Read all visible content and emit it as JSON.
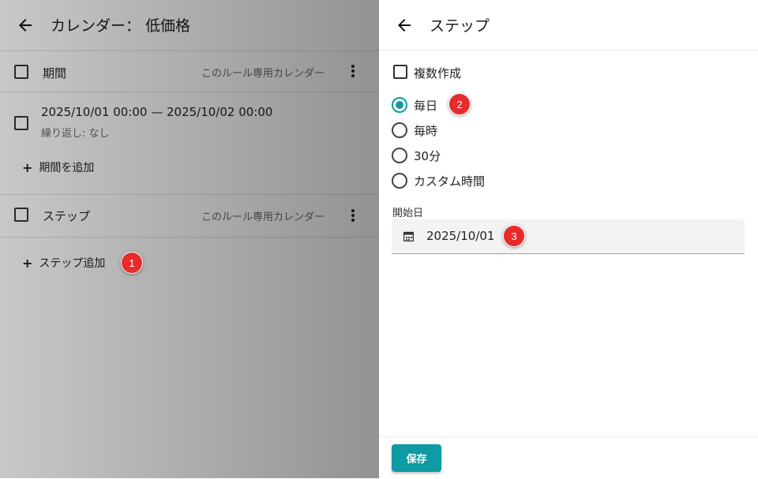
{
  "left_panel": {
    "header_title": "カレンダー： 低価格",
    "period_section": {
      "label": "期間",
      "scope_label": "このルール専用カレンダー"
    },
    "period_entry": {
      "range": "2025/10/01 00:00 — 2025/10/02 00:00",
      "repeat": "繰り返し: なし"
    },
    "add_period_label": "期間を追加",
    "step_section": {
      "label": "ステップ",
      "scope_label": "このルール専用カレンダー"
    },
    "add_step_label": "ステップ追加",
    "badge_1": "1"
  },
  "right_panel": {
    "header_title": "ステップ",
    "multi_create_label": "複数作成",
    "options": [
      "毎日",
      "毎時",
      "30分",
      "カスタム時間"
    ],
    "selected_option": "毎日",
    "badge_2": "2",
    "start_date_label": "開始日",
    "start_date_value": "2025/10/01",
    "badge_3": "3",
    "save_label": "保存"
  },
  "colors": {
    "accent": "#0f9ba3",
    "badge": "#e52b2b"
  }
}
